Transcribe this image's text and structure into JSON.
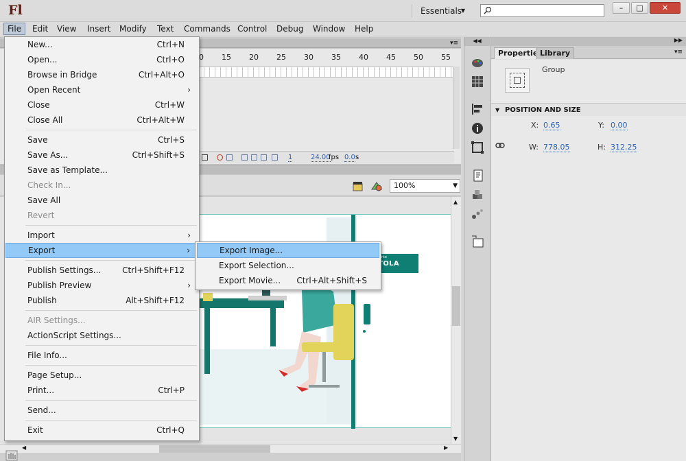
{
  "app": {
    "logo": "Fl"
  },
  "workspace": {
    "label": "Essentials"
  },
  "search": {
    "value": "",
    "placeholder": ""
  },
  "window_controls": {
    "minimize": "–",
    "maximize": "□",
    "close": "✕"
  },
  "menubar": {
    "items": [
      "File",
      "Edit",
      "View",
      "Insert",
      "Modify",
      "Text",
      "Commands",
      "Control",
      "Debug",
      "Window",
      "Help"
    ],
    "active": "File"
  },
  "timeline": {
    "frame_numbers": [
      "0",
      "15",
      "20",
      "25",
      "30",
      "35",
      "40",
      "45",
      "50",
      "55"
    ],
    "current_frame": "1",
    "fps_value": "24.00",
    "fps_label": "fps",
    "time_value": "0.0",
    "time_unit": "s"
  },
  "edit_bar": {
    "zoom": "100%"
  },
  "canvas": {
    "banner_small": "a konsultante",
    "banner_text": "TA VÍTOLA"
  },
  "properties_panel": {
    "tabs": [
      "Properties",
      "Library"
    ],
    "active_tab": "Properties",
    "instance_type": "Group",
    "section_title": "POSITION AND SIZE",
    "x_label": "X:",
    "x_value": "0.65",
    "y_label": "Y:",
    "y_value": "0.00",
    "w_label": "W:",
    "w_value": "778.05",
    "h_label": "H:",
    "h_value": "312.25"
  },
  "file_menu": {
    "items": [
      {
        "label": "New...",
        "shortcut": "Ctrl+N",
        "arrow": "",
        "enabled": true
      },
      {
        "label": "Open...",
        "shortcut": "Ctrl+O",
        "arrow": "",
        "enabled": true
      },
      {
        "label": "Browse in Bridge",
        "shortcut": "Ctrl+Alt+O",
        "arrow": "",
        "enabled": true
      },
      {
        "label": "Open Recent",
        "shortcut": "",
        "arrow": "›",
        "enabled": true
      },
      {
        "label": "Close",
        "shortcut": "Ctrl+W",
        "arrow": "",
        "enabled": true
      },
      {
        "label": "Close All",
        "shortcut": "Ctrl+Alt+W",
        "arrow": "",
        "enabled": true
      },
      {
        "label": "Save",
        "shortcut": "Ctrl+S",
        "arrow": "",
        "enabled": true
      },
      {
        "label": "Save As...",
        "shortcut": "Ctrl+Shift+S",
        "arrow": "",
        "enabled": true
      },
      {
        "label": "Save as Template...",
        "shortcut": "",
        "arrow": "",
        "enabled": true
      },
      {
        "label": "Check In...",
        "shortcut": "",
        "arrow": "",
        "enabled": false
      },
      {
        "label": "Save All",
        "shortcut": "",
        "arrow": "",
        "enabled": true
      },
      {
        "label": "Revert",
        "shortcut": "",
        "arrow": "",
        "enabled": false
      },
      {
        "label": "Import",
        "shortcut": "",
        "arrow": "›",
        "enabled": true
      },
      {
        "label": "Export",
        "shortcut": "",
        "arrow": "›",
        "enabled": true
      },
      {
        "label": "Publish Settings...",
        "shortcut": "Ctrl+Shift+F12",
        "arrow": "",
        "enabled": true
      },
      {
        "label": "Publish Preview",
        "shortcut": "",
        "arrow": "›",
        "enabled": true
      },
      {
        "label": "Publish",
        "shortcut": "Alt+Shift+F12",
        "arrow": "",
        "enabled": true
      },
      {
        "label": "AIR Settings...",
        "shortcut": "",
        "arrow": "",
        "enabled": false
      },
      {
        "label": "ActionScript Settings...",
        "shortcut": "",
        "arrow": "",
        "enabled": true
      },
      {
        "label": "File Info...",
        "shortcut": "",
        "arrow": "",
        "enabled": true
      },
      {
        "label": "Page Setup...",
        "shortcut": "",
        "arrow": "",
        "enabled": true
      },
      {
        "label": "Print...",
        "shortcut": "Ctrl+P",
        "arrow": "",
        "enabled": true
      },
      {
        "label": "Send...",
        "shortcut": "",
        "arrow": "",
        "enabled": true
      },
      {
        "label": "Exit",
        "shortcut": "Ctrl+Q",
        "arrow": "",
        "enabled": true
      }
    ],
    "highlighted": "Export"
  },
  "export_submenu": {
    "items": [
      {
        "label": "Export Image...",
        "shortcut": ""
      },
      {
        "label": "Export Selection...",
        "shortcut": ""
      },
      {
        "label": "Export Movie...",
        "shortcut": "Ctrl+Alt+Shift+S"
      }
    ],
    "highlighted": "Export Image..."
  },
  "colors": {
    "menu_highlight": "#93c9f7",
    "teal_brand": "#0f7e73",
    "link_value": "#2d65b4"
  }
}
